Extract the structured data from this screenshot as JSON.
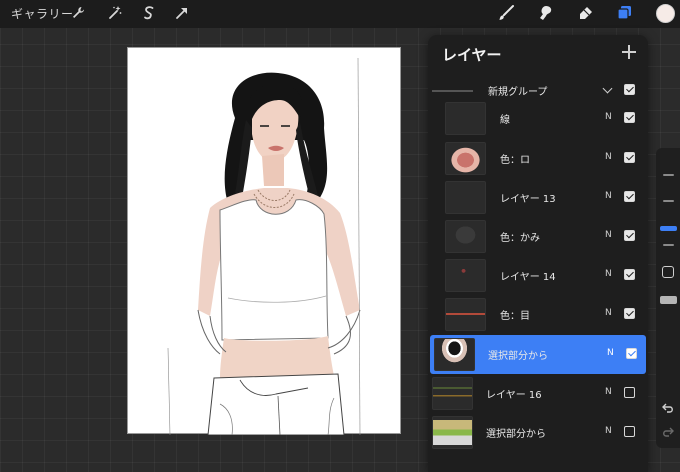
{
  "toolbar": {
    "gallery_label": "ギャラリー",
    "left_icons": [
      "wrench-icon",
      "magic-wand-icon",
      "selection-icon",
      "transform-arrow-icon"
    ],
    "right_icons": [
      "brush-icon",
      "smudge-icon",
      "eraser-icon",
      "layers-icon"
    ],
    "active_tool": "layers",
    "accent_color": "#3d7ff5",
    "current_color": "#f6ebe7"
  },
  "layers_panel": {
    "title": "レイヤー",
    "group": {
      "name": "新規グループ",
      "visible": true,
      "expanded": true
    },
    "layers": [
      {
        "name": "線",
        "blend": "N",
        "visible": true,
        "selected": false,
        "in_group": true
      },
      {
        "name": "色：ロ",
        "blend": "N",
        "visible": true,
        "selected": false,
        "in_group": true
      },
      {
        "name": "レイヤー 13",
        "blend": "N",
        "visible": true,
        "selected": false,
        "in_group": true
      },
      {
        "name": "色：かみ",
        "blend": "N",
        "visible": true,
        "selected": false,
        "in_group": true
      },
      {
        "name": "レイヤー 14",
        "blend": "N",
        "visible": true,
        "selected": false,
        "in_group": true
      },
      {
        "name": "色：目",
        "blend": "N",
        "visible": true,
        "selected": false,
        "in_group": true
      },
      {
        "name": "選択部分から",
        "blend": "N",
        "visible": true,
        "selected": true,
        "in_group": false
      },
      {
        "name": "レイヤー 16",
        "blend": "N",
        "visible": false,
        "selected": false,
        "in_group": false
      },
      {
        "name": "選択部分から",
        "blend": "N",
        "visible": false,
        "selected": false,
        "in_group": false
      }
    ]
  },
  "sidebar": {
    "controls": [
      "brush-size-slider",
      "modify-button",
      "opacity-slider",
      "undo-icon",
      "redo-icon"
    ]
  }
}
